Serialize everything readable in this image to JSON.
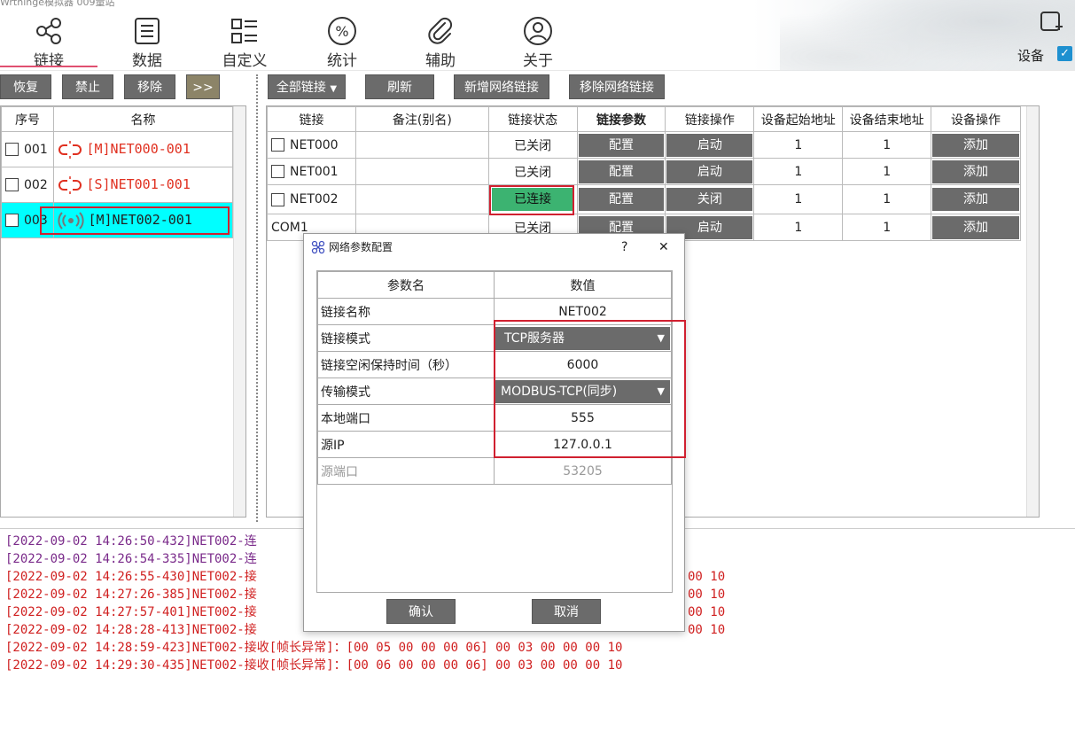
{
  "app": {
    "title": "Wrtnlnge模拟器 009量站"
  },
  "nav": {
    "items": [
      {
        "label": "链接",
        "icon": "share-icon"
      },
      {
        "label": "数据",
        "icon": "document-icon"
      },
      {
        "label": "自定义",
        "icon": "list-icon"
      },
      {
        "label": "统计",
        "icon": "percent-icon"
      },
      {
        "label": "辅助",
        "icon": "paperclip-icon"
      },
      {
        "label": "关于",
        "icon": "user-icon"
      }
    ],
    "device_label": "设备",
    "device_checked": true
  },
  "left_toolbar": {
    "restore": "恢复",
    "disable": "禁止",
    "remove": "移除",
    "expand": ">>"
  },
  "left_table": {
    "headers": {
      "index": "序号",
      "name": "名称"
    },
    "rows": [
      {
        "index": "001",
        "name": "[M]NET000-001",
        "state": "broken"
      },
      {
        "index": "002",
        "name": "[S]NET001-001",
        "state": "broken"
      },
      {
        "index": "003",
        "name": "[M]NET002-001",
        "state": "connected"
      }
    ]
  },
  "main_toolbar": {
    "all_links": "全部链接",
    "refresh": "刷新",
    "add_net": "新增网络链接",
    "remove_net": "移除网络链接"
  },
  "main_table": {
    "headers": {
      "link": "链接",
      "remark": "备注(别名)",
      "status": "链接状态",
      "params": "链接参数",
      "op": "链接操作",
      "start": "设备起始地址",
      "end": "设备结束地址",
      "devop": "设备操作"
    },
    "rows": [
      {
        "link": "NET000",
        "remark": "",
        "status": "已关闭",
        "params": "配置",
        "op": "启动",
        "start": "1",
        "end": "1",
        "devop": "添加",
        "checkbox": true
      },
      {
        "link": "NET001",
        "remark": "",
        "status": "已关闭",
        "params": "配置",
        "op": "启动",
        "start": "1",
        "end": "1",
        "devop": "添加",
        "checkbox": true
      },
      {
        "link": "NET002",
        "remark": "",
        "status": "已连接",
        "params": "配置",
        "op": "关闭",
        "start": "1",
        "end": "1",
        "devop": "添加",
        "checkbox": true
      },
      {
        "link": "COM1",
        "remark": "",
        "status": "已关闭",
        "params": "配置",
        "op": "启动",
        "start": "1",
        "end": "1",
        "devop": "添加",
        "checkbox": false
      }
    ]
  },
  "log": {
    "lines": [
      {
        "prefix": "[2022-09-02 14:26:50-432]NET002-连",
        "rest": "",
        "color": "#7a2a8a"
      },
      {
        "prefix": "[2022-09-02 14:26:54-335]NET002-连",
        "rest": "",
        "color": "#7a2a8a"
      },
      {
        "prefix": "[2022-09-02 14:26:55-430]NET002-接",
        "rest": "00 10",
        "color": "#d02020"
      },
      {
        "prefix": "[2022-09-02 14:27:26-385]NET002-接",
        "rest": "00 10",
        "color": "#d02020"
      },
      {
        "prefix": "[2022-09-02 14:27:57-401]NET002-接",
        "rest": "00 10",
        "color": "#d02020"
      },
      {
        "prefix": "[2022-09-02 14:28:28-413]NET002-接",
        "rest": "00 10",
        "color": "#d02020"
      },
      {
        "prefix": "[2022-09-02 14:28:59-423]NET002-接收[帧长异常]：[00 05 00 00 00 06] 00 03 00 00 00 10",
        "rest": "",
        "color": "#d02020"
      },
      {
        "prefix": "[2022-09-02 14:29:30-435]NET002-接收[帧长异常]：[00 06 00 00 00 06] 00 03 00 00 00 10",
        "rest": "",
        "color": "#d02020"
      }
    ]
  },
  "dialog": {
    "title": "网络参数配置",
    "help": "?",
    "close": "✕",
    "headers": {
      "name": "参数名",
      "value": "数值"
    },
    "rows": [
      {
        "name": "链接名称",
        "value": "NET002",
        "kind": "text"
      },
      {
        "name": "链接模式",
        "value": "TCP服务器",
        "kind": "select"
      },
      {
        "name": "链接空闲保持时间（秒）",
        "value": "6000",
        "kind": "text"
      },
      {
        "name": "传输模式",
        "value": "MODBUS-TCP(同步)",
        "kind": "select"
      },
      {
        "name": "本地端口",
        "value": "555",
        "kind": "text"
      },
      {
        "name": "源IP",
        "value": "127.0.0.1",
        "kind": "text"
      },
      {
        "name": "源端口",
        "value": "53205",
        "kind": "disabled"
      }
    ],
    "ok": "确认",
    "cancel": "取消"
  },
  "colors": {
    "accent": "#e05070",
    "connected": "#3cb371",
    "highlight": "#00ffff",
    "red_box": "#d02030",
    "button": "#6b6b6b"
  }
}
